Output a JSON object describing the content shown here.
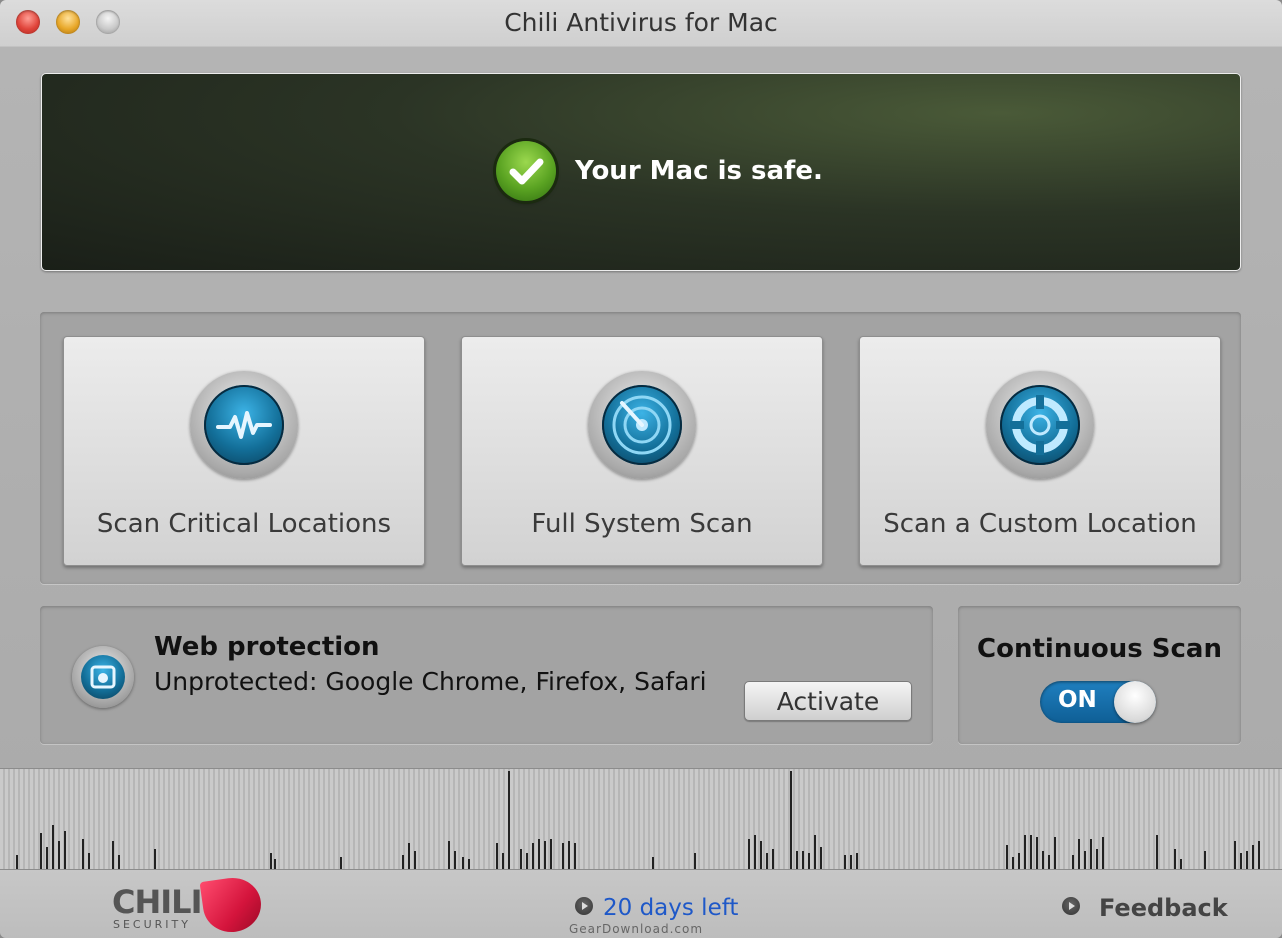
{
  "window": {
    "title": "Chili Antivirus for Mac"
  },
  "status": {
    "message": "Your Mac is safe.",
    "icon": "check-circle-icon",
    "color": "#5aa322"
  },
  "scan_buttons": [
    {
      "label": "Scan Critical Locations",
      "icon": "pulse-icon"
    },
    {
      "label": "Full System Scan",
      "icon": "radar-icon"
    },
    {
      "label": "Scan a Custom Location",
      "icon": "target-icon"
    }
  ],
  "web_protection": {
    "title": "Web protection",
    "status": "Unprotected: Google Chrome, Firefox, Safari",
    "activate_label": "Activate",
    "icon": "browser-shield-icon"
  },
  "continuous_scan": {
    "title": "Continuous Scan",
    "toggle_label": "ON",
    "accent_color": "#1f7fbf"
  },
  "footer": {
    "logo_text": "CHILI",
    "logo_subtext": "SECURITY",
    "days_left": "20 days left",
    "feedback": "Feedback",
    "watermark": "GearDownload.com"
  },
  "colors": {
    "link": "#1e58c8",
    "banner_bg": "#2b3425"
  }
}
